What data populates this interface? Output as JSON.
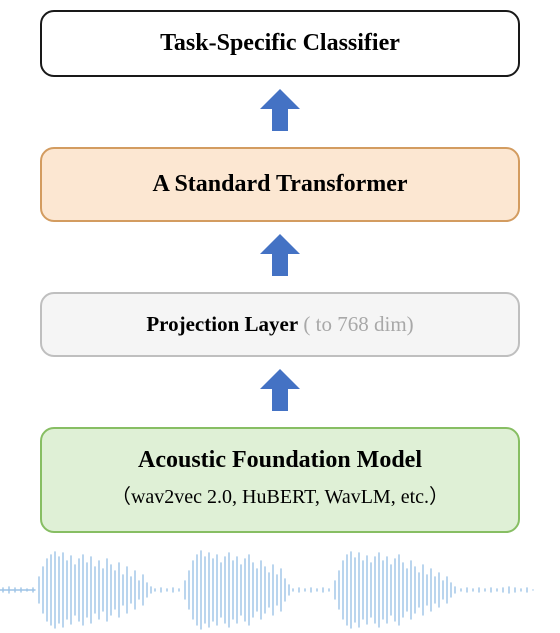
{
  "classifier": {
    "label": "Task-Specific Classifier"
  },
  "transformer": {
    "label": "A Standard Transformer"
  },
  "projection": {
    "label_bold": "Projection  Layer",
    "label_dim": " ( to 768 dim)"
  },
  "foundation": {
    "title": "Acoustic Foundation Model",
    "subtitle": "（wav2vec 2.0, HuBERT, WavLM,  etc.）"
  },
  "arrow_color": "#4472c4",
  "wave_color": "#9dc3e6"
}
